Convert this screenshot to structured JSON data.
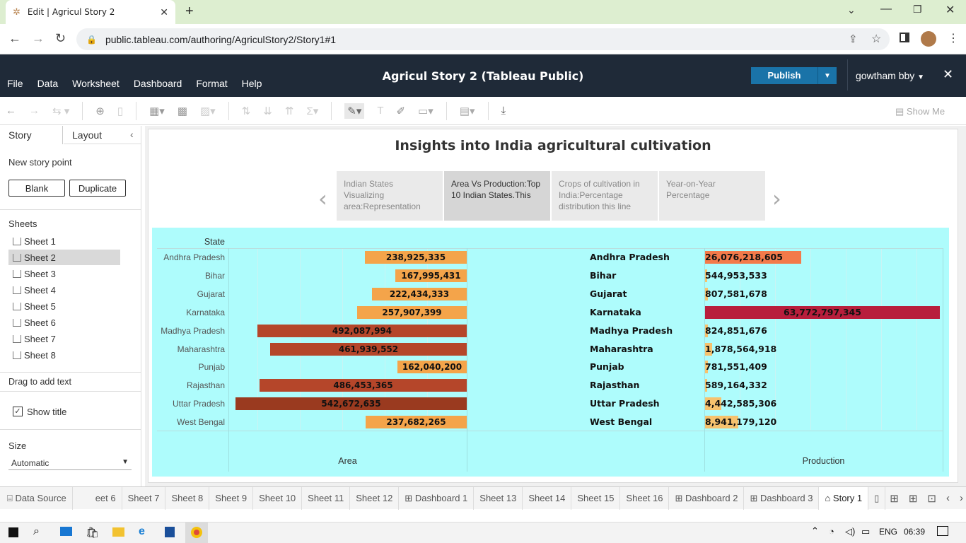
{
  "browser": {
    "tab_title": "Edit | Agricul Story 2",
    "url": "public.tableau.com/authoring/AgriculStory2/Story1#1"
  },
  "tableau": {
    "menu": [
      "File",
      "Data",
      "Worksheet",
      "Dashboard",
      "Format",
      "Help"
    ],
    "app_title": "Agricul Story 2 (Tableau Public)",
    "publish_label": "Publish",
    "user": "gowtham bby",
    "show_me": "Show Me"
  },
  "left_panel": {
    "tab_story": "Story",
    "tab_layout": "Layout",
    "new_story_point": "New story point",
    "blank": "Blank",
    "duplicate": "Duplicate",
    "sheets_header": "Sheets",
    "sheets": [
      "Sheet 1",
      "Sheet 2",
      "Sheet 3",
      "Sheet 4",
      "Sheet 5",
      "Sheet 6",
      "Sheet 7",
      "Sheet 8"
    ],
    "drag_text": "Drag to add text",
    "show_title": "Show title",
    "size_label": "Size",
    "size_value": "Automatic"
  },
  "story": {
    "title": "Insights into India agricultural cultivation",
    "points": [
      "Indian States Visualizing area:Representation",
      "Area Vs Production:Top 10 Indian States.This",
      "Crops of cultivation in India:Percentage distribution this line",
      "Year-on-Year Percentage"
    ]
  },
  "chart_data": {
    "type": "bar",
    "row_header": "State",
    "categories": [
      "Andhra Pradesh",
      "Bihar",
      "Gujarat",
      "Karnataka",
      "Madhya Pradesh",
      "Maharashtra",
      "Punjab",
      "Rajasthan",
      "Uttar Pradesh",
      "West Bengal"
    ],
    "series": [
      {
        "name": "Area",
        "values": [
          238925335,
          167995431,
          222434333,
          257907399,
          492087994,
          461939552,
          162040200,
          486453365,
          542672635,
          237682265
        ],
        "labels": [
          "238,925,335",
          "167,995,431",
          "222,434,333",
          "257,907,399",
          "492,087,994",
          "461,939,552",
          "162,040,200",
          "486,453,365",
          "542,672,635",
          "237,682,265"
        ]
      },
      {
        "name": "Production",
        "values": [
          26076218605,
          544953533,
          807581678,
          63772797345,
          824851676,
          1878564918,
          781551409,
          589164332,
          4442585306,
          8941179120
        ],
        "labels": [
          "26,076,218,605",
          "544,953,533",
          "807,581,678",
          "63,772,797,345",
          "824,851,676",
          "1,878,564,918",
          "781,551,409",
          "589,164,332",
          "4,442,585,306",
          "8,941,179,120"
        ]
      }
    ],
    "xlabels": [
      "Area",
      "Production"
    ]
  },
  "sheet_tabs": [
    "Data Source",
    "eet 6",
    "Sheet 7",
    "Sheet 8",
    "Sheet 9",
    "Sheet 10",
    "Sheet 11",
    "Sheet 12",
    "Dashboard 1",
    "Sheet 13",
    "Sheet 14",
    "Sheet 15",
    "Sheet 16",
    "Dashboard 2",
    "Dashboard 3",
    "Story 1"
  ],
  "taskbar": {
    "lang": "ENG",
    "time": "06:39"
  }
}
